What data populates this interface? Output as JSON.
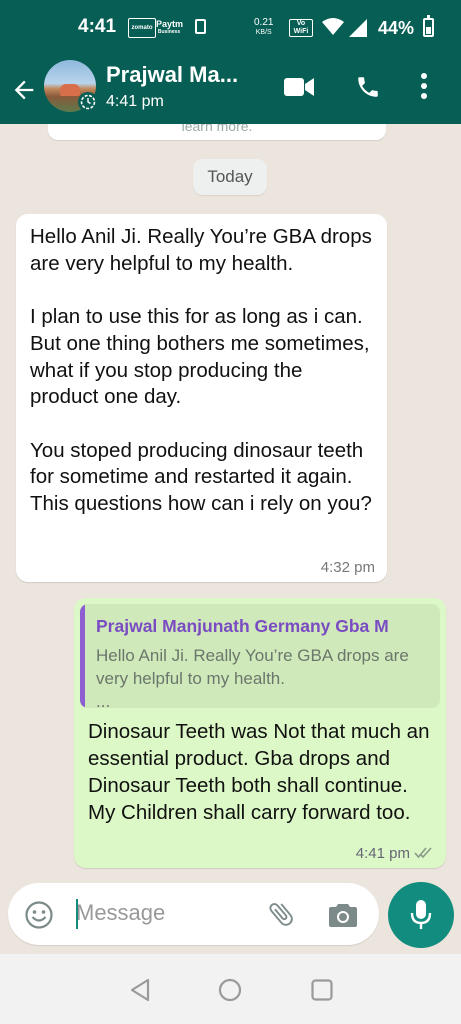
{
  "statusbar": {
    "time": "4:41",
    "speed_value": "0.21",
    "speed_unit": "KB/S",
    "volte_line1": "Vo",
    "volte_line2": "WiFi",
    "battery": "44%",
    "battery_level": 0.44,
    "zomato_label": "zomato",
    "paytm_label": "Paytm",
    "paytm_sub": "Business"
  },
  "appbar": {
    "contact_name": "Prajwal Ma...",
    "subtitle": "4:41 pm",
    "icons": [
      "back-arrow-icon",
      "video-call-icon",
      "voice-call-icon",
      "more-options-icon"
    ]
  },
  "chat": {
    "previous_bubble_text": "learn more.",
    "date_chip": "Today",
    "incoming": {
      "text": "Hello Anil Ji. Really You’re GBA drops are very helpful to my health.\n\nI plan to use this for as long as i can. But one thing bothers me sometimes, what if you stop producing the product one day.\n\nYou stoped producing dinosaur teeth for sometime and restarted it again. This questions how can i rely on you?",
      "time": "4:32 pm"
    },
    "outgoing": {
      "quote_author": "Prajwal Manjunath Germany Gba M",
      "quote_text": "Hello Anil Ji. Really You’re GBA drops are very helpful to my health.",
      "quote_ellipsis": "...",
      "text": "Dinosaur Teeth was Not that much an essential product. Gba drops and Dinosaur Teeth both shall continue. My Children shall carry forward too.",
      "time": "4:41 pm"
    }
  },
  "input": {
    "placeholder": "Message",
    "value": ""
  },
  "colors": {
    "header": "#075e54",
    "accent": "#128c7e",
    "outgoing_bubble": "#dcf8c6",
    "quote_author": "#7a4bc2"
  }
}
